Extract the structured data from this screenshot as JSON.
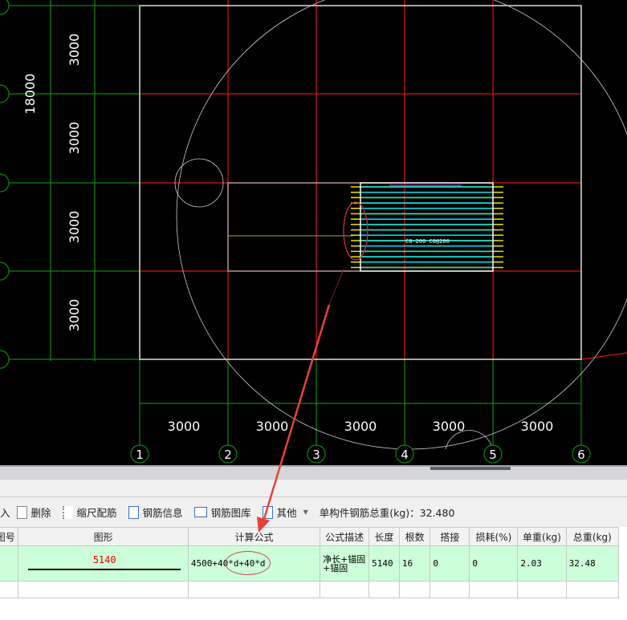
{
  "cad": {
    "row_dims": [
      "3000",
      "3000",
      "3000",
      "3000"
    ],
    "total_dim": "18000",
    "col_dims": [
      "3000",
      "3000",
      "3000",
      "3000",
      "3000"
    ],
    "col_axes": [
      "1",
      "2",
      "3",
      "4",
      "5",
      "6"
    ],
    "rebar_label": "C8-200 C8@200",
    "colors": {
      "grid": "#0a8a0a",
      "axis": "#e01010",
      "slab": "#ffffff",
      "rebar": "#00e5ee",
      "anchor": "#e8e800",
      "annotation": "#e8413a"
    }
  },
  "toolbar": {
    "items": [
      {
        "label": "入",
        "icon": "insert-icon"
      },
      {
        "label": "删除",
        "icon": "delete-icon"
      },
      {
        "label": "缩尺配筋",
        "icon": "scale-rebar-icon"
      },
      {
        "label": "钢筋信息",
        "icon": "rebar-info-icon"
      },
      {
        "label": "钢筋图库",
        "icon": "rebar-library-icon"
      },
      {
        "label": "其他",
        "icon": "other-icon"
      }
    ],
    "total_weight": "单构件钢筋总重(kg)：32.480"
  },
  "table": {
    "headers": [
      "图号",
      "图形",
      "计算公式",
      "公式描述",
      "长度",
      "根数",
      "搭接",
      "损耗(%)",
      "单重(kg)",
      "总重(kg)"
    ],
    "rows": [
      {
        "shape_length": "5140",
        "formula": "4500+40*d+40*d",
        "description": "净长+锚固+锚固",
        "length": "5140",
        "count": "16",
        "lap": "0",
        "loss": "0",
        "unit_weight": "2.03",
        "total_weight": "32.48"
      }
    ]
  }
}
